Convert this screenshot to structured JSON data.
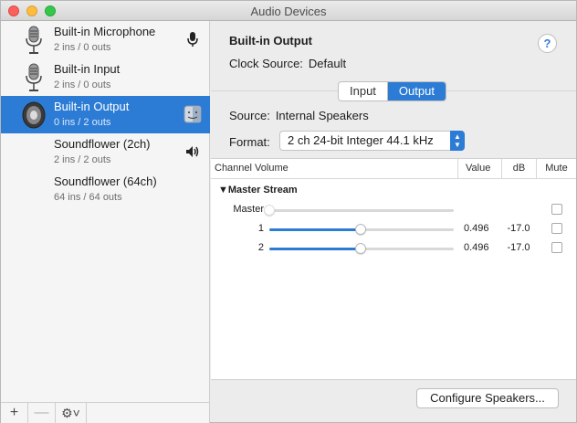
{
  "window": {
    "title": "Audio Devices"
  },
  "devices": [
    {
      "name": "Built-in Microphone",
      "io": "2 ins / 0 outs",
      "icon": "microphone-icon",
      "badge": "microphone-badge-icon"
    },
    {
      "name": "Built-in Input",
      "io": "2 ins / 0 outs",
      "icon": "microphone-icon",
      "badge": ""
    },
    {
      "name": "Built-in Output",
      "io": "0 ins / 2 outs",
      "icon": "speaker-icon",
      "badge": "finder-badge-icon",
      "selected": true
    },
    {
      "name": "Soundflower (2ch)",
      "io": "2 ins / 2 outs",
      "icon": "",
      "badge": "speaker-badge-icon"
    },
    {
      "name": "Soundflower (64ch)",
      "io": "64 ins / 64 outs",
      "icon": "",
      "badge": ""
    }
  ],
  "sidebar_toolbar": {
    "add": "+",
    "remove": "—",
    "gear": "⚙︎˅"
  },
  "detail": {
    "device_title": "Built-in Output",
    "help": "?",
    "clock_label": "Clock Source:",
    "clock_value": "Default",
    "tabs": [
      "Input",
      "Output"
    ],
    "active_tab": "Output",
    "source_label": "Source:",
    "source_value": "Internal Speakers",
    "format_label": "Format:",
    "format_value": "2 ch 24-bit Integer 44.1 kHz"
  },
  "table": {
    "headers": {
      "channel_volume": "Channel Volume",
      "value": "Value",
      "db": "dB",
      "mute": "Mute"
    },
    "stream": "Master Stream",
    "rows": [
      {
        "label": "Master",
        "value": "",
        "db": "",
        "level": 0.0,
        "enabled": false,
        "muted": false
      },
      {
        "label": "1",
        "value": "0.496",
        "db": "-17.0",
        "level": 0.496,
        "enabled": true,
        "muted": false
      },
      {
        "label": "2",
        "value": "0.496",
        "db": "-17.0",
        "level": 0.496,
        "enabled": true,
        "muted": false
      }
    ]
  },
  "configure_button": "Configure Speakers...",
  "colors": {
    "accent": "#2c7cd5",
    "selection": "#2c7cd5"
  }
}
